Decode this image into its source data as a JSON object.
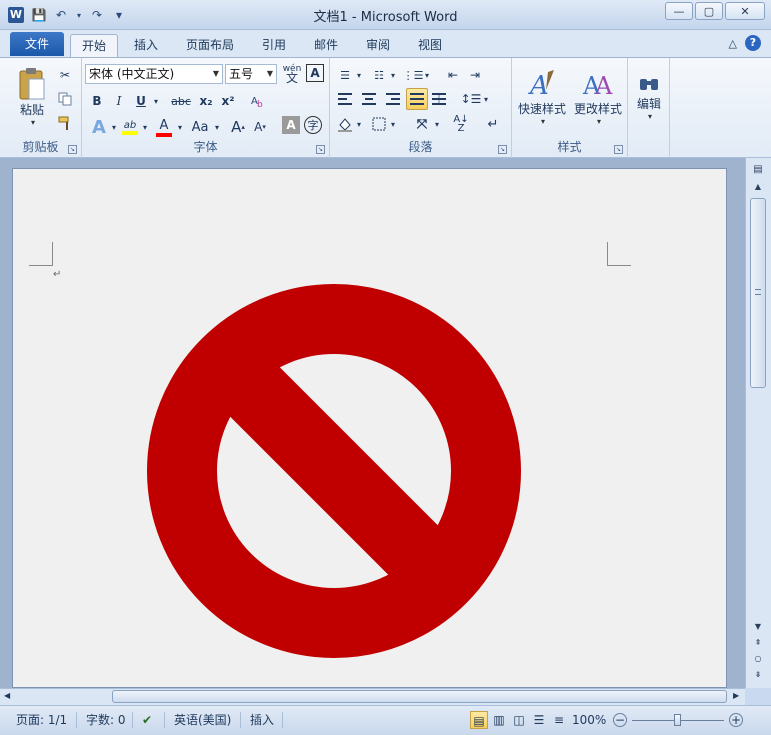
{
  "window": {
    "title": "文档1 - Microsoft Word",
    "minimize": "—",
    "maximize": "▢",
    "close": "✕"
  },
  "qat": {
    "app_icon": "W",
    "save": "💾",
    "undo": "↶",
    "redo": "↷",
    "customize": "▾"
  },
  "tabs": {
    "file": "文件",
    "items": [
      "开始",
      "插入",
      "页面布局",
      "引用",
      "邮件",
      "审阅",
      "视图"
    ],
    "active": "开始",
    "ribbon_minimize": "△",
    "help": "?"
  },
  "ribbon": {
    "clipboard": {
      "label": "剪贴板",
      "paste": "粘贴"
    },
    "font": {
      "label": "字体",
      "font_name": "宋体 (中文正文)",
      "font_size": "五号",
      "wen": "wén",
      "bold": "B",
      "italic": "I",
      "underline": "U",
      "strike": "abc",
      "sub": "x₂",
      "sup": "x²",
      "grow": "A",
      "shrink": "A",
      "aa": "Aa",
      "text_highlight_color": "#ffff00",
      "font_color": "#ff0000"
    },
    "paragraph": {
      "label": "段落"
    },
    "styles": {
      "label": "样式",
      "quick": "快速样式",
      "change": "更改样式"
    },
    "editing": {
      "label": "编辑",
      "find": "编辑"
    }
  },
  "status": {
    "page": "页面: 1/1",
    "words": "字数: 0",
    "language": "英语(美国)",
    "mode": "插入",
    "zoom": "100%"
  },
  "colors": {
    "sign_red": "#c00000",
    "page_bg": "#f0f0f0"
  },
  "zoom_level": 100
}
